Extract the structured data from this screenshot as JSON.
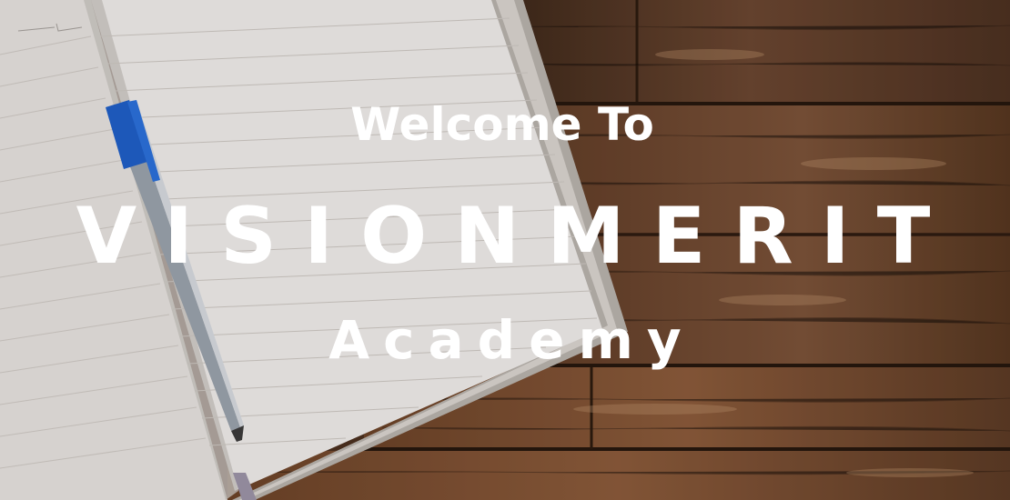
{
  "banner": {
    "line1": "Welcome To",
    "line2": "VISIONMERIT",
    "line3": "Academy"
  },
  "colors": {
    "text": "#ffffff",
    "wood": "#5a3a26",
    "paper": "#ece9e6",
    "pen": "#1e5fc8"
  }
}
